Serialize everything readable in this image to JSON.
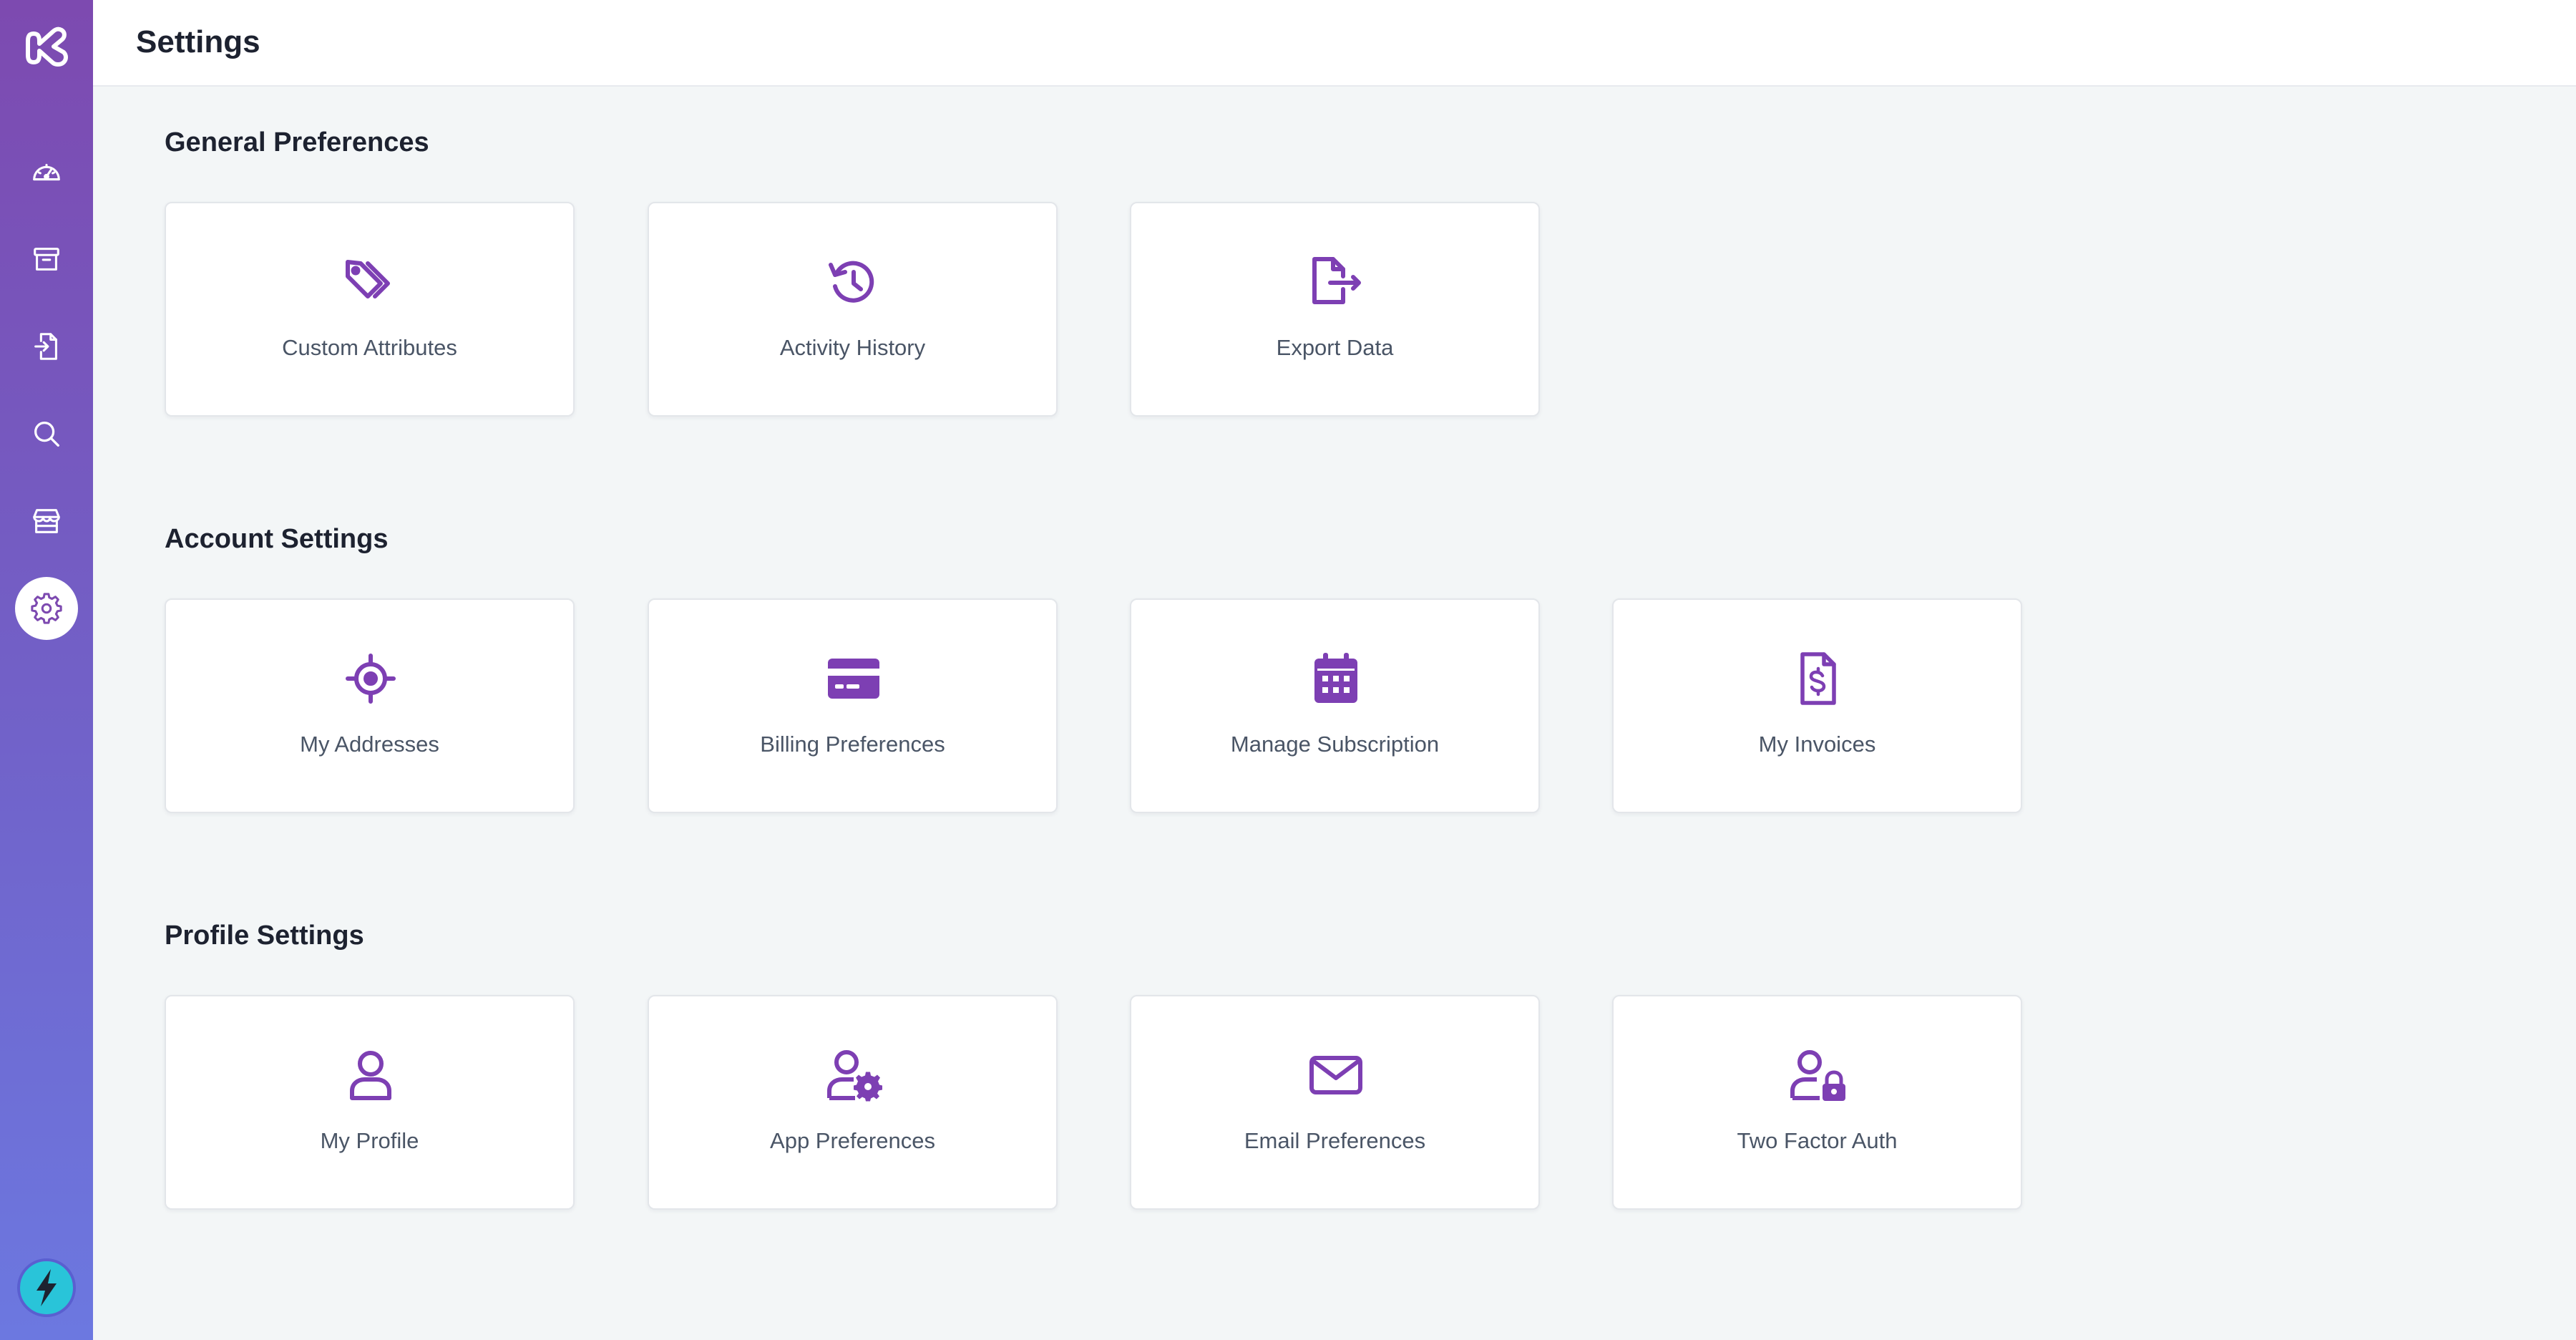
{
  "header": {
    "title": "Settings"
  },
  "colors": {
    "accent": "#7d3fb3",
    "sidebar_top": "#7d4ab0",
    "sidebar_bottom": "#6c78e0",
    "bolt": "#29c4d9"
  },
  "sidebar": {
    "items": [
      {
        "icon": "dashboard-gauge-icon"
      },
      {
        "icon": "archive-box-icon"
      },
      {
        "icon": "file-import-icon"
      },
      {
        "icon": "search-icon"
      },
      {
        "icon": "store-icon"
      },
      {
        "icon": "gear-icon",
        "active": true
      }
    ],
    "footer_icon": "lightning-bolt-icon"
  },
  "sections": [
    {
      "title": "General Preferences",
      "cards": [
        {
          "label": "Custom Attributes",
          "icon": "tags-icon"
        },
        {
          "label": "Activity History",
          "icon": "history-icon"
        },
        {
          "label": "Export Data",
          "icon": "file-export-icon"
        }
      ]
    },
    {
      "title": "Account Settings",
      "cards": [
        {
          "label": "My Addresses",
          "icon": "crosshair-location-icon"
        },
        {
          "label": "Billing Preferences",
          "icon": "credit-card-icon"
        },
        {
          "label": "Manage Subscription",
          "icon": "calendar-icon"
        },
        {
          "label": "My Invoices",
          "icon": "invoice-dollar-icon"
        }
      ]
    },
    {
      "title": "Profile Settings",
      "cards": [
        {
          "label": "My Profile",
          "icon": "user-icon"
        },
        {
          "label": "App Preferences",
          "icon": "user-gear-icon"
        },
        {
          "label": "Email Preferences",
          "icon": "envelope-icon"
        },
        {
          "label": "Two Factor Auth",
          "icon": "user-lock-icon"
        }
      ]
    }
  ]
}
